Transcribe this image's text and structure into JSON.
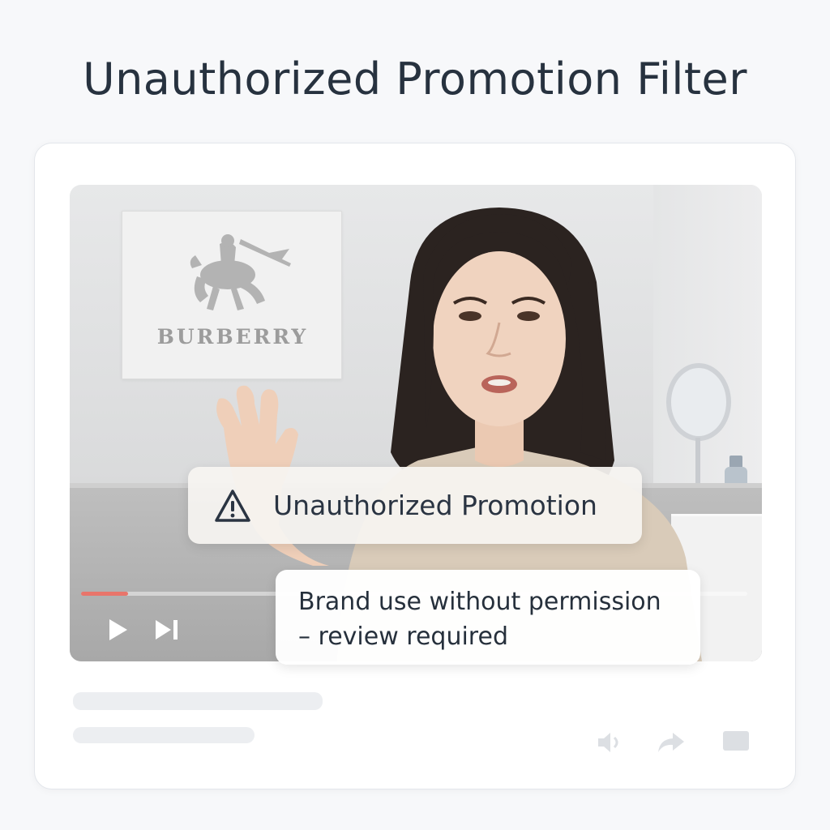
{
  "header": {
    "title": "Unauthorized Promotion Filter"
  },
  "video": {
    "brand_sign": "BURBERRY",
    "progress": 0.07,
    "controls": {
      "play_icon": "play-icon",
      "next_icon": "skip-next-icon"
    }
  },
  "alert": {
    "icon": "warning-triangle-icon",
    "label": "Unauthorized Promotion"
  },
  "detail": {
    "line1": "Brand use without permission",
    "line2": "– review required"
  },
  "footer": {
    "icons": [
      "speaker-icon",
      "share-icon",
      "comment-icon"
    ]
  },
  "colors": {
    "title": "#27323f",
    "progress": "#e8756b",
    "text": "#26303c"
  }
}
